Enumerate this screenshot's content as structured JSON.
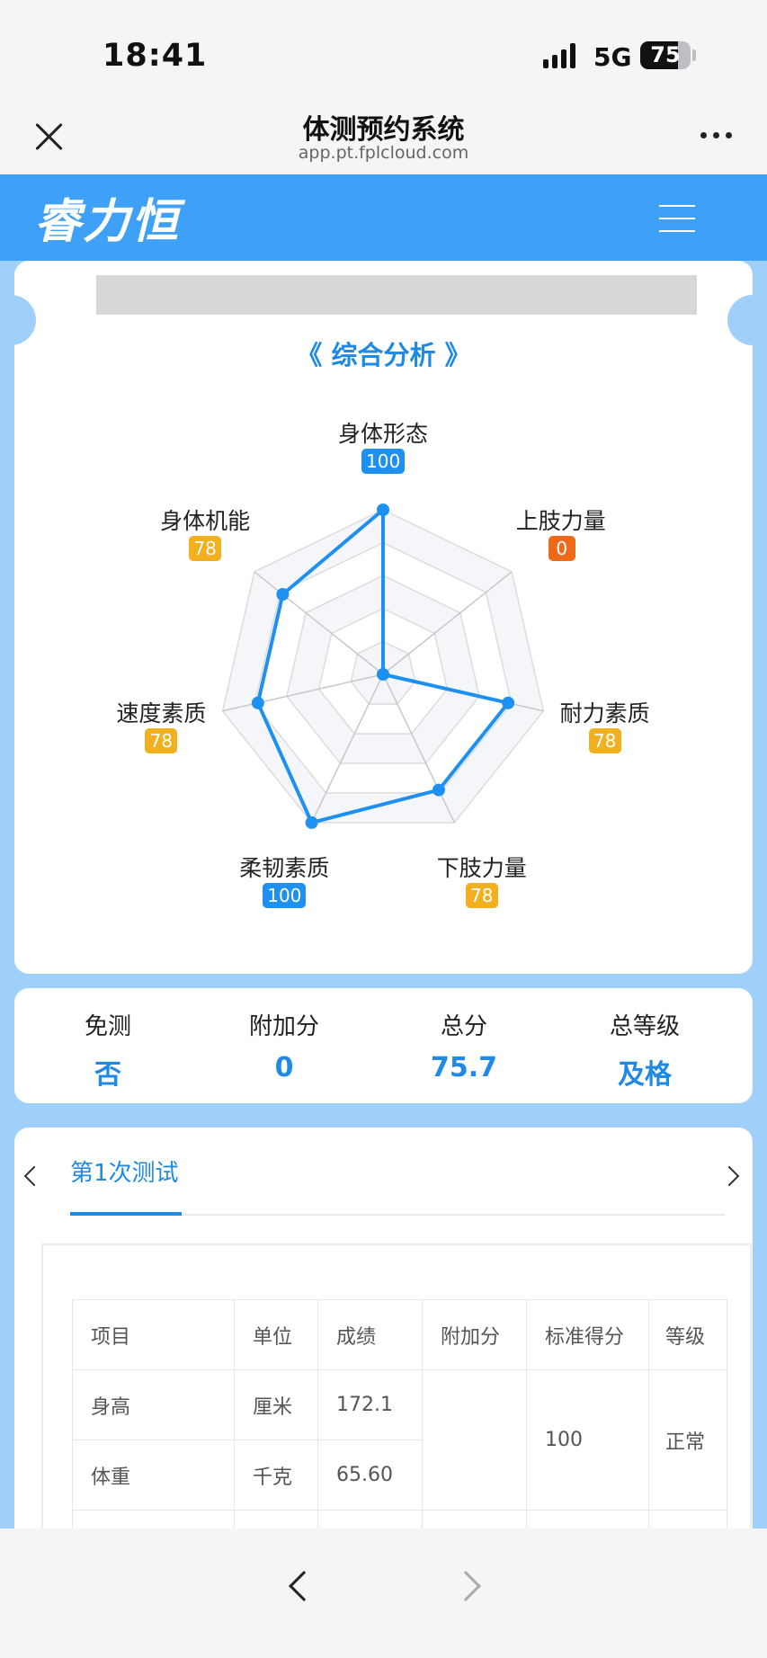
{
  "status_bar": {
    "time": "18:41",
    "network": "5G",
    "battery": "75",
    "battery_level": 0.75
  },
  "browser": {
    "title": "体测预约系统",
    "url": "app.pt.fplcloud.com"
  },
  "app": {
    "logo": "睿力恒"
  },
  "analysis": {
    "title": "《 综合分析 》",
    "chart_data": {
      "type": "radar",
      "axes": [
        "身体形态",
        "上肢力量",
        "耐力素质",
        "下肢力量",
        "柔韧素质",
        "速度素质",
        "身体机能"
      ],
      "values": [
        100,
        0,
        78,
        78,
        100,
        78,
        78
      ],
      "max": 100,
      "badge_colors": [
        "#1e90f0",
        "#ee6a1a",
        "#f2b01e",
        "#f2b01e",
        "#1e90f0",
        "#f2b01e",
        "#f2b01e"
      ],
      "line_color": "#1e90f0"
    }
  },
  "summary": [
    {
      "label": "免测",
      "value": "否"
    },
    {
      "label": "附加分",
      "value": "0"
    },
    {
      "label": "总分",
      "value": "75.7"
    },
    {
      "label": "总等级",
      "value": "及格"
    }
  ],
  "tests": {
    "active_tab": "第1次测试",
    "table": {
      "headers": [
        "项目",
        "单位",
        "成绩",
        "附加分",
        "标准得分",
        "等级"
      ],
      "rows": [
        {
          "item": "身高",
          "unit": "厘米",
          "result": "172.1"
        },
        {
          "item": "体重",
          "unit": "千克",
          "result": "65.60"
        }
      ],
      "merged_score": "100",
      "merged_level": "正常"
    }
  }
}
